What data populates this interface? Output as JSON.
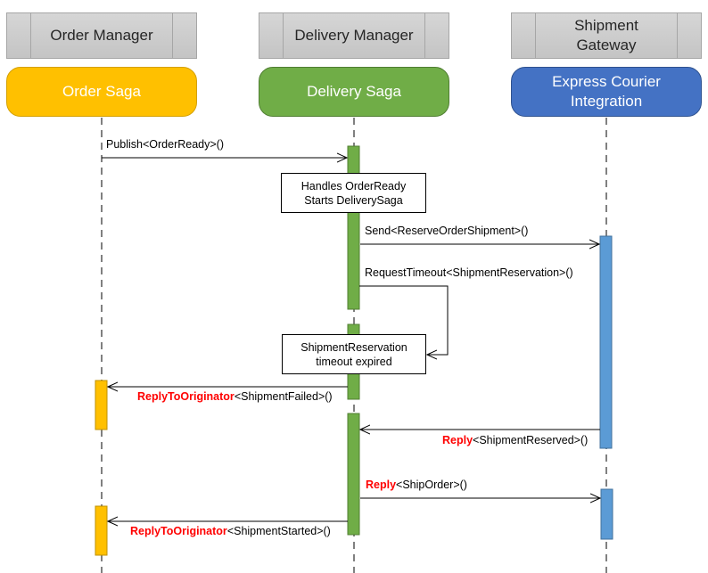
{
  "colors": {
    "order_saga": "#ffc000",
    "delivery_saga": "#70ad47",
    "express_courier": "#4472c4",
    "activation_blue": "#5b9bd5",
    "keyword": "#ff0000"
  },
  "participants": [
    {
      "header": "Order Manager",
      "saga": "Order Saga"
    },
    {
      "header": "Delivery Manager",
      "saga": "Delivery Saga"
    },
    {
      "header_line1": "Shipment",
      "header_line2": "Gateway",
      "saga_line1": "Express Courier",
      "saga_line2": "Integration"
    }
  ],
  "notes": {
    "handles": {
      "line1": "Handles OrderReady",
      "line2": "Starts DeliverySaga"
    },
    "timeout": {
      "line1": "ShipmentReservation",
      "line2": "timeout expired"
    }
  },
  "messages": [
    {
      "keyword": "",
      "text": "Publish<OrderReady>()"
    },
    {
      "keyword": "",
      "text": "Send<ReserveOrderShipment>()"
    },
    {
      "keyword": "",
      "text": "RequestTimeout<ShipmentReservation>()"
    },
    {
      "keyword": "ReplyToOriginator",
      "text": "<ShipmentFailed>()"
    },
    {
      "keyword": "Reply",
      "text": "<ShipmentReserved>()"
    },
    {
      "keyword": "Reply",
      "text": "<ShipOrder>()"
    },
    {
      "keyword": "ReplyToOriginator",
      "text": "<ShipmentStarted>()"
    }
  ]
}
